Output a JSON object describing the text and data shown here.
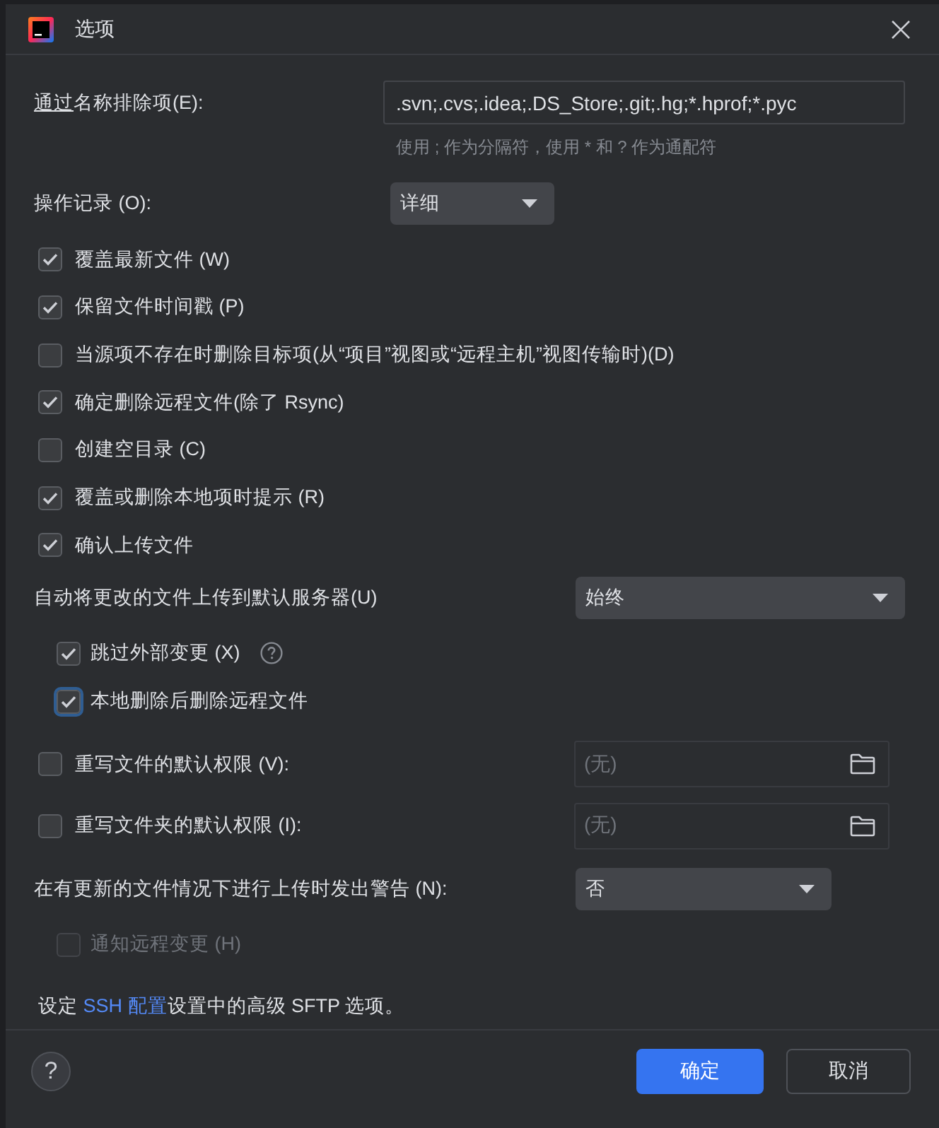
{
  "window": {
    "title": "选项"
  },
  "exclude": {
    "label": {
      "underlined": "通过",
      "rest": "名称排除项(E):"
    },
    "value": ".svn;.cvs;.idea;.DS_Store;.git;.hg;*.hprof;*.pyc",
    "hint": "使用 ; 作为分隔符，使用 * 和 ? 作为通配符"
  },
  "log": {
    "label": "操作记录 (O):",
    "value": "详细"
  },
  "rows": [
    {
      "kind": "checkbox",
      "label": "覆盖最新文件 (W)",
      "checked": true
    },
    {
      "kind": "checkbox",
      "label": "保留文件时间戳 (P)",
      "checked": true
    },
    {
      "kind": "checkbox",
      "label": "当源项不存在时删除目标项(从“项目”视图或“远程主机”视图传输时)(D)",
      "checked": false
    },
    {
      "kind": "checkbox",
      "label": "确定删除远程文件(除了 Rsync)",
      "checked": true
    },
    {
      "kind": "checkbox",
      "label": "创建空目录 (C)",
      "checked": false
    },
    {
      "kind": "checkbox",
      "label": "覆盖或删除本地项时提示 (R)",
      "checked": true
    },
    {
      "kind": "checkbox",
      "label": "确认上传文件",
      "checked": true
    },
    {
      "kind": "dropdown",
      "label": "自动将更改的文件上传到默认服务器(U)",
      "value": "始终",
      "children": [
        {
          "kind": "checkbox",
          "label": "跳过外部变更 (X)",
          "checked": true,
          "focused": false,
          "disabled": false,
          "help": true
        },
        {
          "kind": "checkbox",
          "label": "本地删除后删除远程文件",
          "checked": true,
          "focused": true,
          "disabled": false,
          "help": false
        }
      ]
    },
    {
      "kind": "path",
      "label": "重写文件的默认权限 (V):",
      "checked": false,
      "placeholder": "(无)"
    },
    {
      "kind": "path",
      "label": "重写文件夹的默认权限 (I):",
      "checked": false,
      "placeholder": "(无)"
    },
    {
      "kind": "dropdown",
      "label": "在有更新的文件情况下进行上传时发出警告 (N):",
      "value": "否",
      "children": [
        {
          "kind": "checkbox",
          "label": "通知远程变更 (H)",
          "checked": false,
          "focused": false,
          "disabled": true,
          "help": false
        }
      ]
    }
  ],
  "note": {
    "before": "设定 ",
    "link": "SSH 配置",
    "after": "设置中的高级 SFTP 选项。"
  },
  "footer": {
    "help": "?",
    "buttons": [
      {
        "label": "确定",
        "kind": "primary"
      },
      {
        "label": "取消",
        "kind": "secondary"
      }
    ]
  }
}
